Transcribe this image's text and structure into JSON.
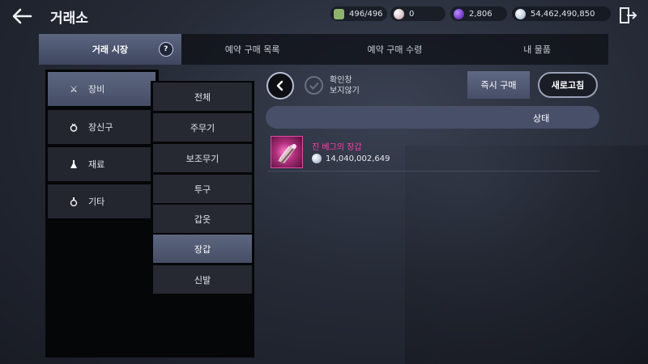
{
  "header": {
    "title": "거래소",
    "resources": [
      {
        "name": "bag-capacity",
        "value": "496/496",
        "color": "#8fb36a"
      },
      {
        "name": "pearl",
        "value": "0",
        "color": "#d9c3c9"
      },
      {
        "name": "dark-crystal",
        "value": "2,806",
        "color": "#7a3fc9"
      },
      {
        "name": "silver",
        "value": "54,462,490,850",
        "color": "#c7d3e3"
      }
    ]
  },
  "tabs": [
    {
      "label": "거래 시장",
      "active": true,
      "badge": "?"
    },
    {
      "label": "예약 구매 목록",
      "active": false
    },
    {
      "label": "예약 구매 수령",
      "active": false
    },
    {
      "label": "내 물품",
      "active": false
    }
  ],
  "categories": [
    {
      "label": "장비",
      "icon": "crossed-swords-icon",
      "active": true
    },
    {
      "label": "장신구",
      "icon": "ring-icon",
      "active": false
    },
    {
      "label": "재료",
      "icon": "flask-icon",
      "active": false
    },
    {
      "label": "기타",
      "icon": "potion-icon",
      "active": false
    }
  ],
  "subcategories": [
    {
      "label": "전체",
      "active": false
    },
    {
      "label": "주무기",
      "active": false
    },
    {
      "label": "보조무기",
      "active": false
    },
    {
      "label": "투구",
      "active": false
    },
    {
      "label": "갑옷",
      "active": false
    },
    {
      "label": "장갑",
      "active": true
    },
    {
      "label": "신발",
      "active": false
    }
  ],
  "toolbar": {
    "confirm_line1": "확인창",
    "confirm_line2": "보지않기",
    "buy_label": "즉시 구매",
    "refresh_label": "새로고침"
  },
  "list": {
    "header_label": "상태",
    "items": [
      {
        "name": "진 베그의 장갑",
        "price": "14,040,002,649",
        "name_color": "#ff3fae"
      }
    ]
  }
}
